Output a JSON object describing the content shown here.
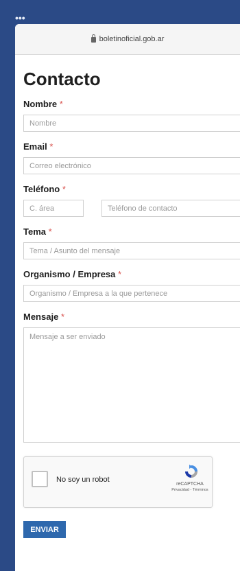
{
  "browser": {
    "url": "boletinoficial.gob.ar"
  },
  "page": {
    "title": "Contacto"
  },
  "form": {
    "required_mark": "*",
    "nombre": {
      "label": "Nombre",
      "placeholder": "Nombre"
    },
    "email": {
      "label": "Email",
      "placeholder": "Correo electrónico"
    },
    "telefono": {
      "label": "Teléfono",
      "area_placeholder": "C. área",
      "phone_placeholder": "Teléfono de contacto"
    },
    "tema": {
      "label": "Tema",
      "placeholder": "Tema / Asunto del mensaje"
    },
    "organismo": {
      "label": "Organismo / Empresa",
      "placeholder": "Organismo / Empresa a la que pertenece"
    },
    "mensaje": {
      "label": "Mensaje",
      "placeholder": "Mensaje a ser enviado"
    },
    "captcha": {
      "label": "No soy un robot",
      "brand": "reCAPTCHA",
      "links": "Privacidad - Términos"
    },
    "submit_label": "ENVIAR"
  },
  "colors": {
    "background": "#2b4a86",
    "button": "#2e68ad",
    "required": "#d9534f"
  }
}
